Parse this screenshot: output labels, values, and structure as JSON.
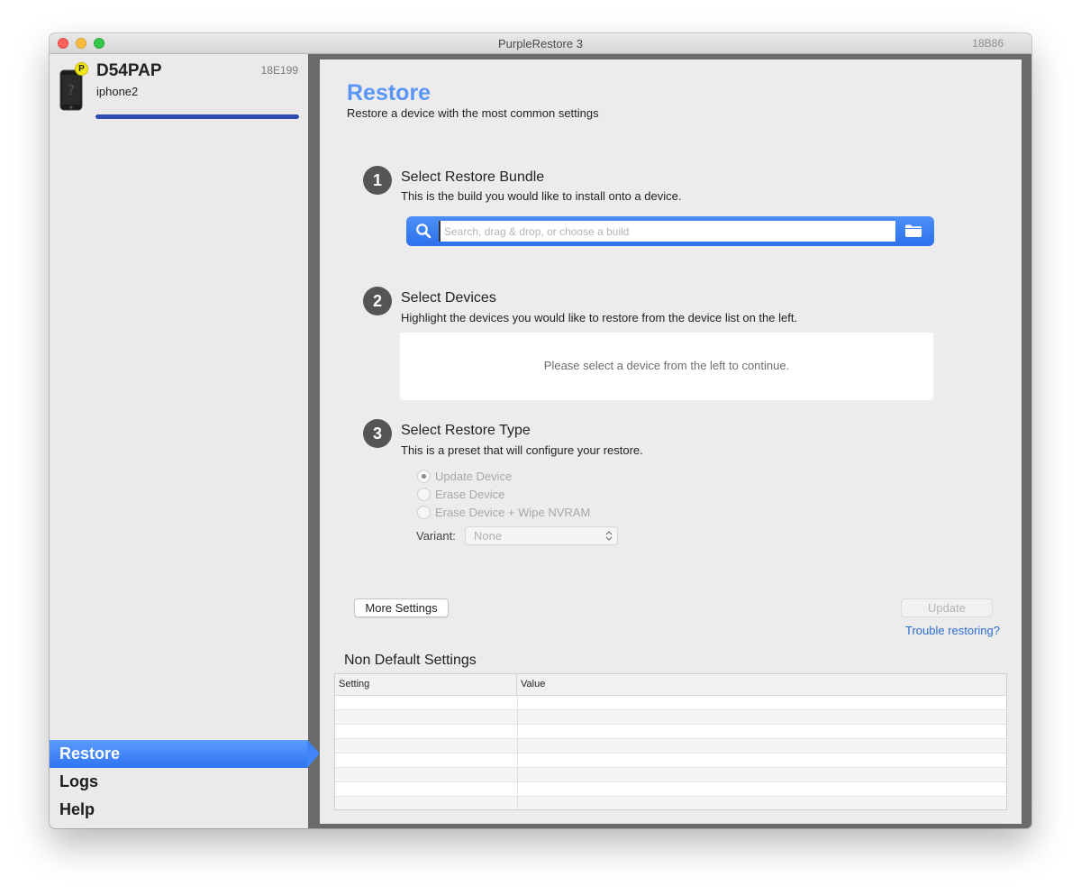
{
  "window": {
    "title": "PurpleRestore 3",
    "build": "18B86"
  },
  "sidebar": {
    "device": {
      "name": "D54PAP",
      "build": "18E199",
      "subtitle": "iphone2",
      "badge": "P",
      "progress": 1.0
    },
    "nav": [
      {
        "label": "Restore",
        "active": true
      },
      {
        "label": "Logs",
        "active": false
      },
      {
        "label": "Help",
        "active": false
      }
    ]
  },
  "restore": {
    "title": "Restore",
    "subtitle": "Restore a device with the most common settings",
    "steps": [
      {
        "number": "1",
        "title": "Select Restore Bundle",
        "desc": "This is the build you would like to install onto a device."
      },
      {
        "number": "2",
        "title": "Select Devices",
        "desc": "Highlight the devices you would like to restore from the device list on the left."
      },
      {
        "number": "3",
        "title": "Select Restore Type",
        "desc": "This is a preset that will configure your restore."
      }
    ],
    "search": {
      "placeholder": "Search, drag & drop, or choose a build",
      "value": ""
    },
    "device_box_message": "Please select a device from the left to continue.",
    "restore_types": [
      {
        "label": "Update Device",
        "checked": true
      },
      {
        "label": "Erase Device",
        "checked": false
      },
      {
        "label": "Erase Device + Wipe NVRAM",
        "checked": false
      }
    ],
    "variant": {
      "label": "Variant:",
      "value": "None"
    },
    "more_settings_label": "More Settings",
    "update_label": "Update",
    "trouble_link": "Trouble restoring?",
    "non_default": {
      "title": "Non Default Settings",
      "columns": [
        "Setting",
        "Value"
      ],
      "rows": []
    }
  },
  "colors": {
    "accent": "#5a95f5",
    "nav_active": "#3f84f8",
    "link": "#2e6bd3"
  }
}
